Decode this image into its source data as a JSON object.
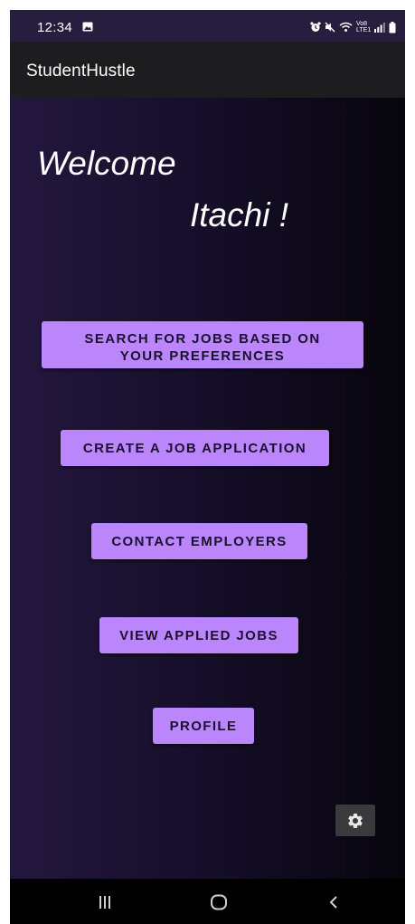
{
  "status_bar": {
    "time": "12:34",
    "network_label": "Vo8 LTE1",
    "icons": [
      "gallery-icon",
      "alarm-icon",
      "mute-icon",
      "wifi-icon",
      "signal-icon",
      "battery-icon"
    ]
  },
  "app_bar": {
    "title": "StudentHustle"
  },
  "main": {
    "greeting": "Welcome",
    "username": "Itachi !",
    "buttons": [
      {
        "label": "SEARCH FOR JOBS BASED ON YOUR PREFERENCES"
      },
      {
        "label": "CREATE A JOB APPLICATION"
      },
      {
        "label": "CONTACT EMPLOYERS"
      },
      {
        "label": "VIEW APPLIED JOBS"
      },
      {
        "label": "PROFILE"
      }
    ],
    "settings_icon": "gear-icon"
  },
  "nav_bar": {
    "icons": [
      "recent-apps-icon",
      "home-icon",
      "back-icon"
    ]
  },
  "colors": {
    "accent": "#bb86fc",
    "status_bar": "#261d3f",
    "app_bar": "#1d1d1f",
    "background_start": "#24173f",
    "background_end": "#07050d"
  }
}
